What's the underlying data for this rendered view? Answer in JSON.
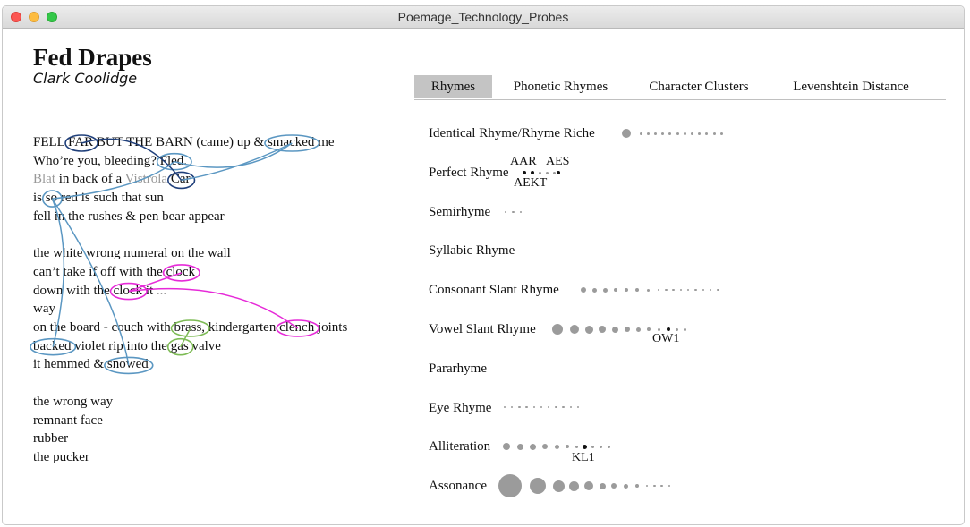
{
  "window": {
    "title": "Poemage_Technology_Probes"
  },
  "poem": {
    "title": "Fed Drapes",
    "author": "Clark Coolidge",
    "lines": [
      {
        "parts": [
          {
            "t": "FELL "
          },
          {
            "t": "FAR",
            "id": "far"
          },
          {
            "t": " BUT THE BARN (came) up & "
          },
          {
            "t": "smacked",
            "id": "smacked"
          },
          {
            "t": " me"
          }
        ]
      },
      {
        "parts": [
          {
            "t": "Who’re you, bleeding? "
          },
          {
            "t": "Fled.",
            "id": "fled"
          }
        ]
      },
      {
        "parts": [
          {
            "t": "Blat",
            "grey": true
          },
          {
            "t": " in back of a "
          },
          {
            "t": "Vistrola",
            "grey": true
          },
          {
            "t": " "
          },
          {
            "t": "Car",
            "id": "car"
          }
        ]
      },
      {
        "parts": [
          {
            "t": "is "
          },
          {
            "t": "so",
            "id": "so"
          },
          {
            "t": " red is such that sun"
          }
        ]
      },
      {
        "parts": [
          {
            "t": "fell in the rushes & pen bear appear"
          }
        ]
      },
      {
        "parts": []
      },
      {
        "parts": [
          {
            "t": "the white wrong numeral on the wall"
          }
        ]
      },
      {
        "parts": [
          {
            "t": "can’t take if off with the "
          },
          {
            "t": "clock",
            "id": "clock1"
          }
        ]
      },
      {
        "parts": [
          {
            "t": "down with the "
          },
          {
            "t": "clock",
            "id": "clock2"
          },
          {
            "t": " it "
          },
          {
            "t": "...",
            "grey": true
          }
        ]
      },
      {
        "parts": [
          {
            "t": "way"
          }
        ]
      },
      {
        "parts": [
          {
            "t": "on the board "
          },
          {
            "t": "-",
            "grey": true
          },
          {
            "t": " couch with "
          },
          {
            "t": "brass,",
            "id": "brass"
          },
          {
            "t": " kindergarten "
          },
          {
            "t": "clench",
            "id": "clench"
          },
          {
            "t": " joints"
          }
        ]
      },
      {
        "parts": [
          {
            "t": "backed",
            "id": "backed"
          },
          {
            "t": " violet rip into the "
          },
          {
            "t": "gas",
            "id": "gas"
          },
          {
            "t": " valve"
          }
        ]
      },
      {
        "parts": [
          {
            "t": "it hemmed & "
          },
          {
            "t": "snowed",
            "id": "snowed"
          }
        ]
      },
      {
        "parts": []
      },
      {
        "parts": [
          {
            "t": "the wrong way"
          }
        ]
      },
      {
        "parts": [
          {
            "t": "remnant face"
          }
        ]
      },
      {
        "parts": [
          {
            "t": "rubber"
          }
        ]
      },
      {
        "parts": [
          {
            "t": "the pucker"
          }
        ]
      }
    ]
  },
  "tabs": [
    {
      "label": "Rhymes",
      "active": true
    },
    {
      "label": "Phonetic Rhymes",
      "active": false
    },
    {
      "label": "Character Clusters",
      "active": false
    },
    {
      "label": "Levenshtein Distance",
      "active": false
    }
  ],
  "rhyme_types": [
    {
      "label": "Identical Rhyme/Rhyme Riche"
    },
    {
      "label": "Perfect Rhyme"
    },
    {
      "label": "Semirhyme"
    },
    {
      "label": "Syllabic Rhyme"
    },
    {
      "label": "Consonant Slant Rhyme"
    },
    {
      "label": "Vowel Slant Rhyme"
    },
    {
      "label": "Pararhyme"
    },
    {
      "label": "Eye Rhyme"
    },
    {
      "label": "Alliteration"
    },
    {
      "label": "Assonance"
    }
  ],
  "annotations": {
    "perfect_1": "AAR",
    "perfect_2": "AES",
    "perfect_3": "AEKT",
    "vowel_slant": "OW1",
    "alliteration": "KL1"
  },
  "colors": {
    "dark_blue": "#1f3f7a",
    "light_blue": "#5b97c2",
    "magenta": "#e62ad8",
    "green": "#7dbb55",
    "dot_grey": "#9b9b9b",
    "tab_active": "#c4c4c4"
  }
}
